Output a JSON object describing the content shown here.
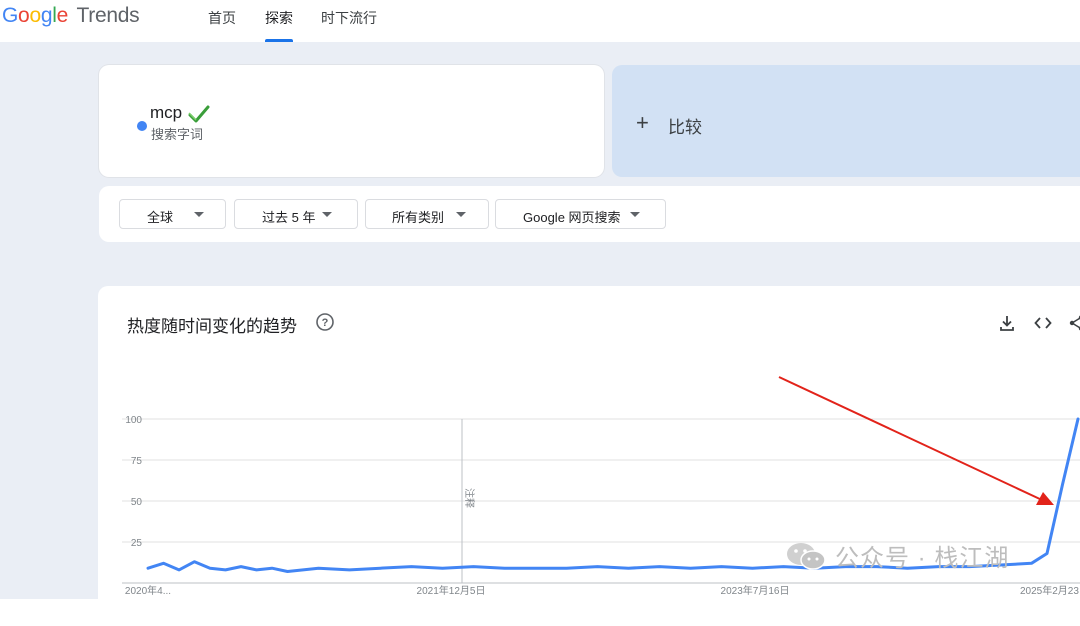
{
  "brand": {
    "google": "Google",
    "trends": "Trends"
  },
  "nav": {
    "home": "首页",
    "explore": "探索",
    "trending": "时下流行"
  },
  "search_term": {
    "name": "mcp",
    "type": "搜索字词",
    "color": "#4285f4"
  },
  "compare": {
    "plus": "+",
    "label": "比较"
  },
  "filters": {
    "region": "全球",
    "period": "过去 5 年",
    "category": "所有类别",
    "property": "Google 网页搜索"
  },
  "chart_section": {
    "title": "热度随时间变化的趋势"
  },
  "chart_data": {
    "type": "line",
    "ylim": [
      0,
      100
    ],
    "yticks": [
      100,
      75,
      50,
      25
    ],
    "xtick_labels": [
      "2020年4...",
      "2021年12月5日",
      "2023年7月16日",
      "2025年2月23"
    ],
    "annotation": "注释",
    "series": [
      {
        "color": "#4285f4",
        "x": [
          "2020-04",
          "2020-05",
          "2020-06",
          "2020-07",
          "2020-08",
          "2020-09",
          "2020-10",
          "2020-11",
          "2020-12",
          "2021-01",
          "2021-03",
          "2021-05",
          "2021-07",
          "2021-09",
          "2021-11",
          "2022-01",
          "2022-03",
          "2022-05",
          "2022-07",
          "2022-09",
          "2022-11",
          "2023-01",
          "2023-03",
          "2023-05",
          "2023-07",
          "2023-09",
          "2023-11",
          "2024-01",
          "2024-03",
          "2024-05",
          "2024-07",
          "2024-09",
          "2024-11",
          "2025-01",
          "2025-02",
          "2025-03",
          "2025-04"
        ],
        "values": [
          9,
          12,
          8,
          13,
          9,
          8,
          10,
          8,
          9,
          7,
          9,
          8,
          9,
          10,
          9,
          10,
          9,
          9,
          9,
          10,
          9,
          10,
          9,
          10,
          9,
          10,
          9,
          10,
          10,
          9,
          10,
          10,
          11,
          12,
          18,
          60,
          100
        ]
      }
    ]
  },
  "watermark": "公众号 · 栈江湖",
  "colors": {
    "accent": "#1a73e8",
    "band": "#eaeef5",
    "compare_bg": "#d2e1f4",
    "line": "#4285f4",
    "arrow": "#e2231a"
  }
}
